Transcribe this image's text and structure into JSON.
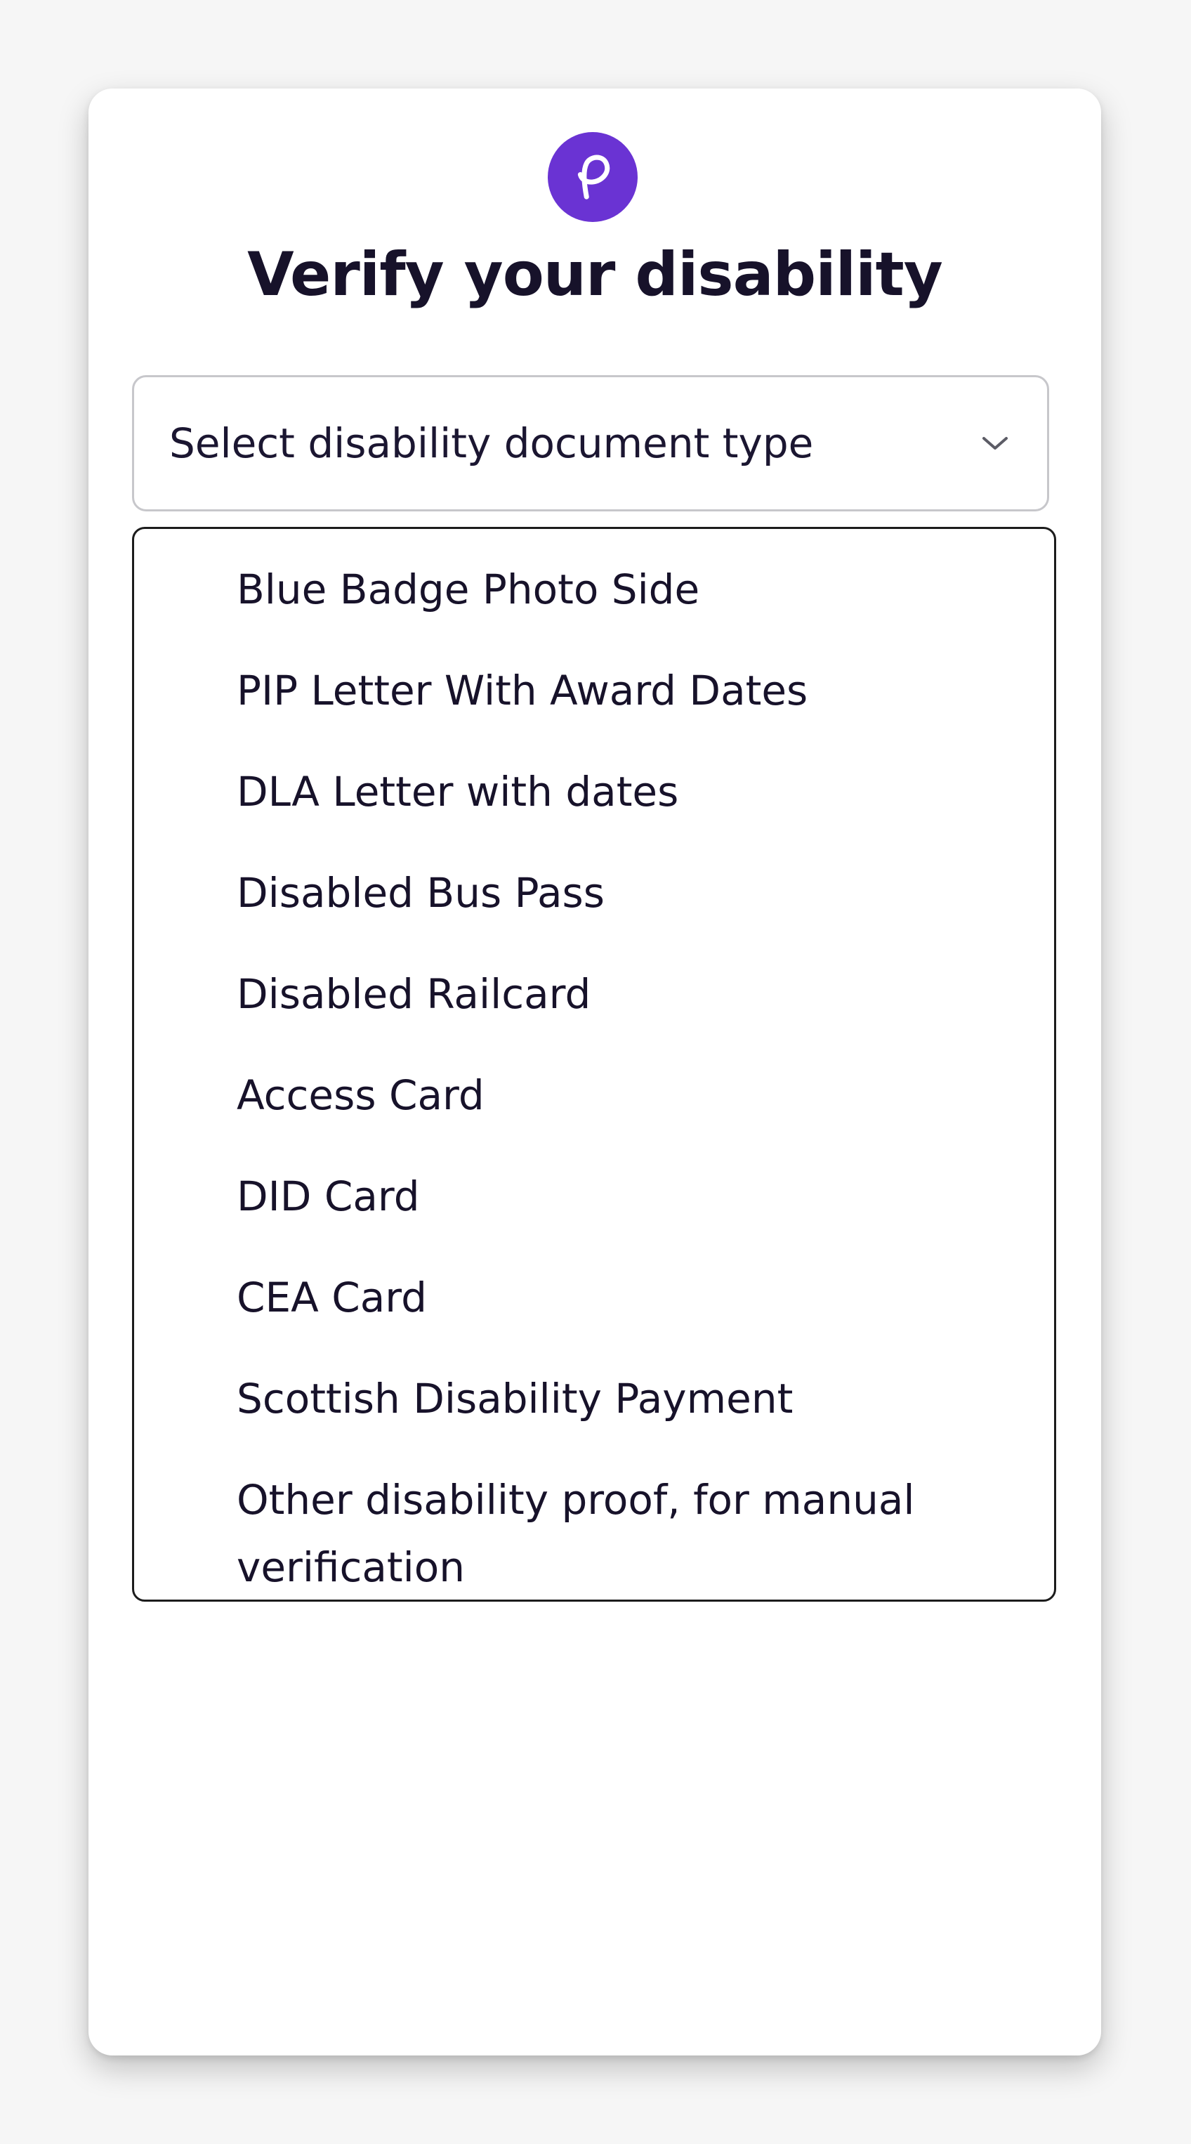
{
  "page": {
    "title": "Verify your disability",
    "logo_icon": "brand-logo-icon",
    "brand_color": "#6a33d3"
  },
  "select": {
    "placeholder": "Select disability document type",
    "icon": "chevron-down-icon"
  },
  "options": [
    {
      "label": "Blue Badge Photo Side"
    },
    {
      "label": "PIP Letter With Award Dates"
    },
    {
      "label": "DLA Letter with dates"
    },
    {
      "label": "Disabled Bus Pass"
    },
    {
      "label": "Disabled Railcard"
    },
    {
      "label": "Access Card"
    },
    {
      "label": "DID Card"
    },
    {
      "label": "CEA Card"
    },
    {
      "label": "Scottish Disability Payment"
    },
    {
      "label": "Other disability proof, for manual verification"
    }
  ]
}
